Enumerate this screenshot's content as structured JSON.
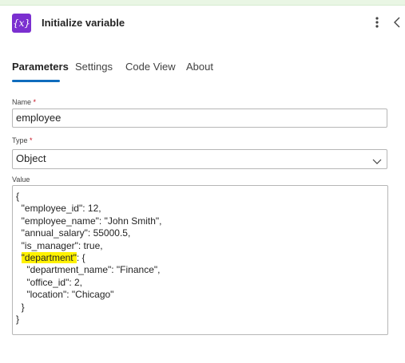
{
  "header": {
    "icon_text": "{x}",
    "title": "Initialize variable"
  },
  "tabs": [
    {
      "label": "Parameters",
      "active": true
    },
    {
      "label": "Settings",
      "active": false
    },
    {
      "label": "Code View",
      "active": false
    },
    {
      "label": "About",
      "active": false
    }
  ],
  "fields": {
    "name": {
      "label": "Name",
      "required_mark": "*",
      "value": "employee"
    },
    "type": {
      "label": "Type",
      "required_mark": "*",
      "value": "Object"
    },
    "value": {
      "label": "Value"
    }
  },
  "value_lines": [
    {
      "indent": "",
      "parts": [
        {
          "text": "{",
          "highlight": false
        }
      ]
    },
    {
      "indent": "  ",
      "parts": [
        {
          "text": "\"employee_id\": 12,",
          "highlight": false
        }
      ]
    },
    {
      "indent": "  ",
      "parts": [
        {
          "text": "\"employee_name\": \"John Smith\",",
          "highlight": false
        }
      ]
    },
    {
      "indent": "  ",
      "parts": [
        {
          "text": "\"annual_salary\": 55000.5,",
          "highlight": false
        }
      ]
    },
    {
      "indent": "  ",
      "parts": [
        {
          "text": "\"is_manager\": true,",
          "highlight": false
        }
      ]
    },
    {
      "indent": "  ",
      "parts": [
        {
          "text": "\"department\"",
          "highlight": true
        },
        {
          "text": ": {",
          "highlight": false
        }
      ]
    },
    {
      "indent": "    ",
      "parts": [
        {
          "text": "\"department_name\": \"Finance\",",
          "highlight": false
        }
      ]
    },
    {
      "indent": "    ",
      "parts": [
        {
          "text": "\"office_id\": 2,",
          "highlight": false
        }
      ]
    },
    {
      "indent": "    ",
      "parts": [
        {
          "text": "\"location\": \"Chicago\"",
          "highlight": false
        }
      ]
    },
    {
      "indent": "  ",
      "parts": [
        {
          "text": "}",
          "highlight": false
        }
      ]
    },
    {
      "indent": "",
      "parts": [
        {
          "text": "}",
          "highlight": false
        }
      ]
    }
  ],
  "colors": {
    "accent": "#0f6cbd",
    "action_icon_bg": "#7b2fd0",
    "highlight": "#fff200",
    "required": "#c50f1f",
    "top_strip": "#e9f6e4"
  }
}
